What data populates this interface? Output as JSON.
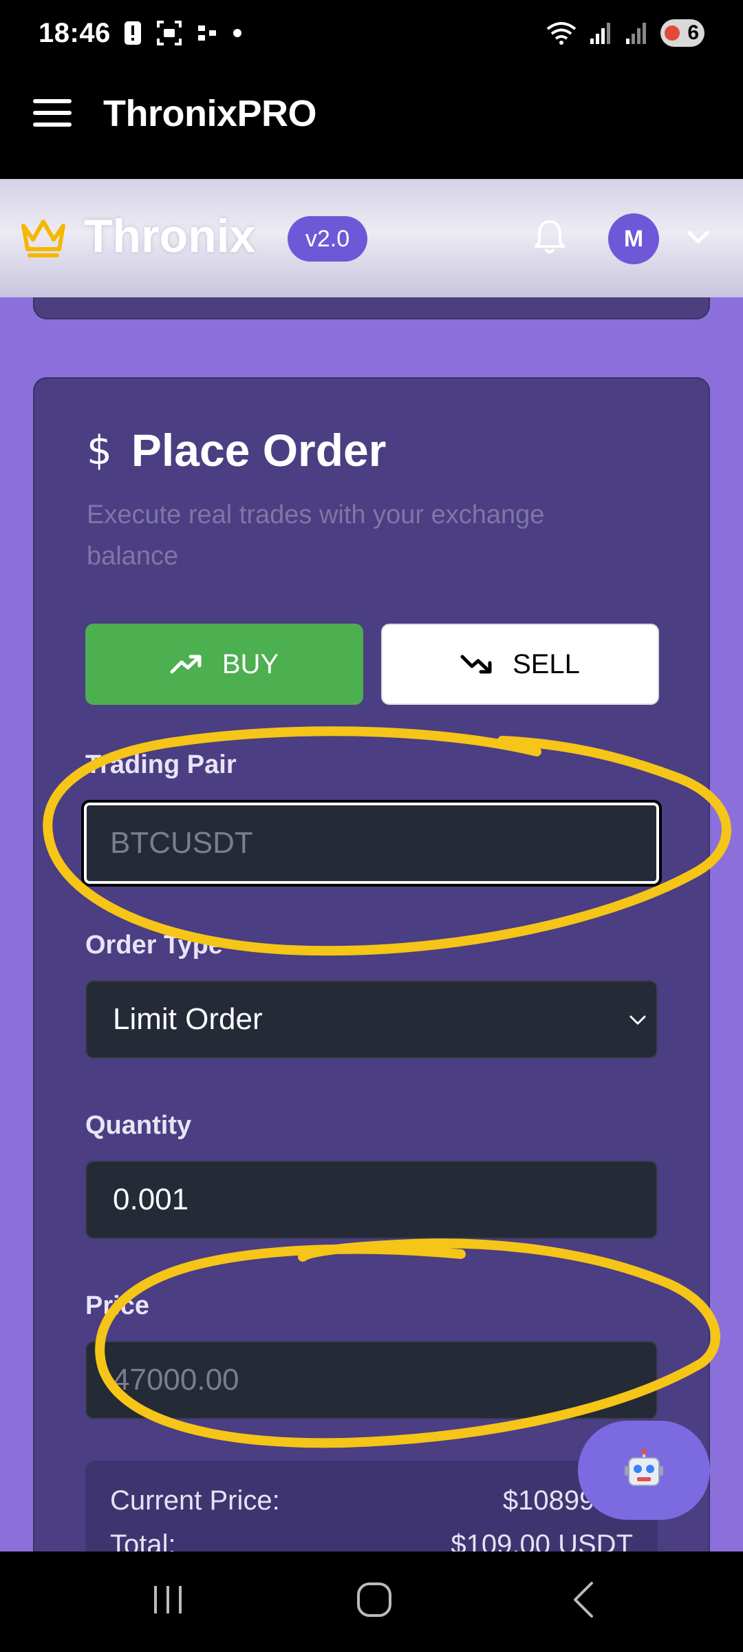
{
  "status_bar": {
    "time": "18:46",
    "battery": "6"
  },
  "app_bar": {
    "title": "ThronixPRO"
  },
  "site_header": {
    "brand": "Thronix",
    "version": "v2.0",
    "avatar_initial": "M"
  },
  "order_card": {
    "title": "Place Order",
    "subtitle": "Execute real trades with your exchange balance",
    "buy_label": "BUY",
    "sell_label": "SELL",
    "trading_pair_label": "Trading Pair",
    "trading_pair_placeholder": "BTCUSDT",
    "order_type_label": "Order Type",
    "order_type_value": "Limit Order",
    "quantity_label": "Quantity",
    "quantity_value": "0.001",
    "price_label": "Price",
    "price_placeholder": "47000.00"
  },
  "summary": {
    "current_price_label": "Current Price:",
    "current_price_value": "$108996.0",
    "total_label": "Total:",
    "total_value": "$109.00 USDT"
  },
  "colors": {
    "buy": "#4caf50",
    "accent": "#6f58d8",
    "annotation": "#f5c518",
    "background": "#8b6fdb"
  }
}
